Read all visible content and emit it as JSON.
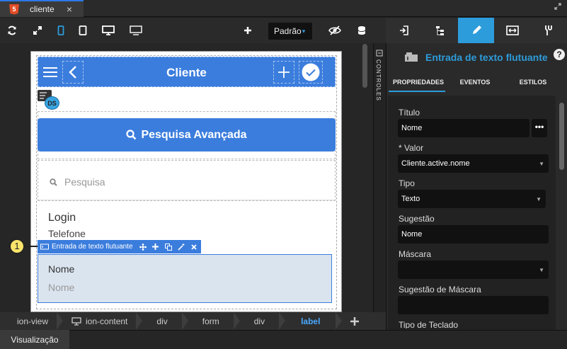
{
  "tab": {
    "icon_text": "5",
    "title": "cliente",
    "close": "×"
  },
  "toolbar": {
    "icons": [
      "refresh-icon",
      "expand-icon",
      "mobile-icon",
      "tablet-icon",
      "desktop-icon",
      "monitor-icon",
      "plus-icon",
      "eye-slash-icon",
      "database-icon"
    ],
    "theme_select": "Padrão",
    "theme_caret": "▾"
  },
  "phone": {
    "header_title": "Cliente",
    "datasource_badge": "DS",
    "advanced_search_label": "Pesquisa Avançada",
    "search_placeholder": "Pesquisa",
    "list_item": {
      "title": "Login",
      "subtitle": "Telefone"
    },
    "selected_field": {
      "label": "Nome",
      "placeholder": "Nome"
    }
  },
  "selection_bar": {
    "label": "Entrada de texto flutuante",
    "marker": "1"
  },
  "side_tab": {
    "label": "CONTROLES"
  },
  "breadcrumbs": [
    "ion-view",
    "ion-content",
    "div",
    "form",
    "div",
    "label"
  ],
  "breadcrumb_active": "label",
  "bottom": {
    "tab_label": "Visualização"
  },
  "right_panel": {
    "component_title": "Entrada de texto flutuante",
    "help": "?",
    "subtabs": [
      "PROPRIEDADES",
      "EVENTOS",
      "ESTILOS"
    ],
    "properties": [
      {
        "label": "Título",
        "value": "Nome"
      },
      {
        "label": "* Valor",
        "value": "Cliente.active.nome"
      },
      {
        "label": "Tipo",
        "value": "Texto"
      },
      {
        "label": "Sugestão",
        "value": "Nome"
      },
      {
        "label": "Máscara",
        "value": ""
      },
      {
        "label": "Sugestão de Máscara",
        "value": ""
      },
      {
        "label": "Tipo de Teclado",
        "value": ""
      }
    ],
    "more_button": "•••"
  },
  "colors": {
    "accent": "#2d9cdb",
    "ionic_primary": "#3b7ddd",
    "html5": "#e44d26"
  }
}
